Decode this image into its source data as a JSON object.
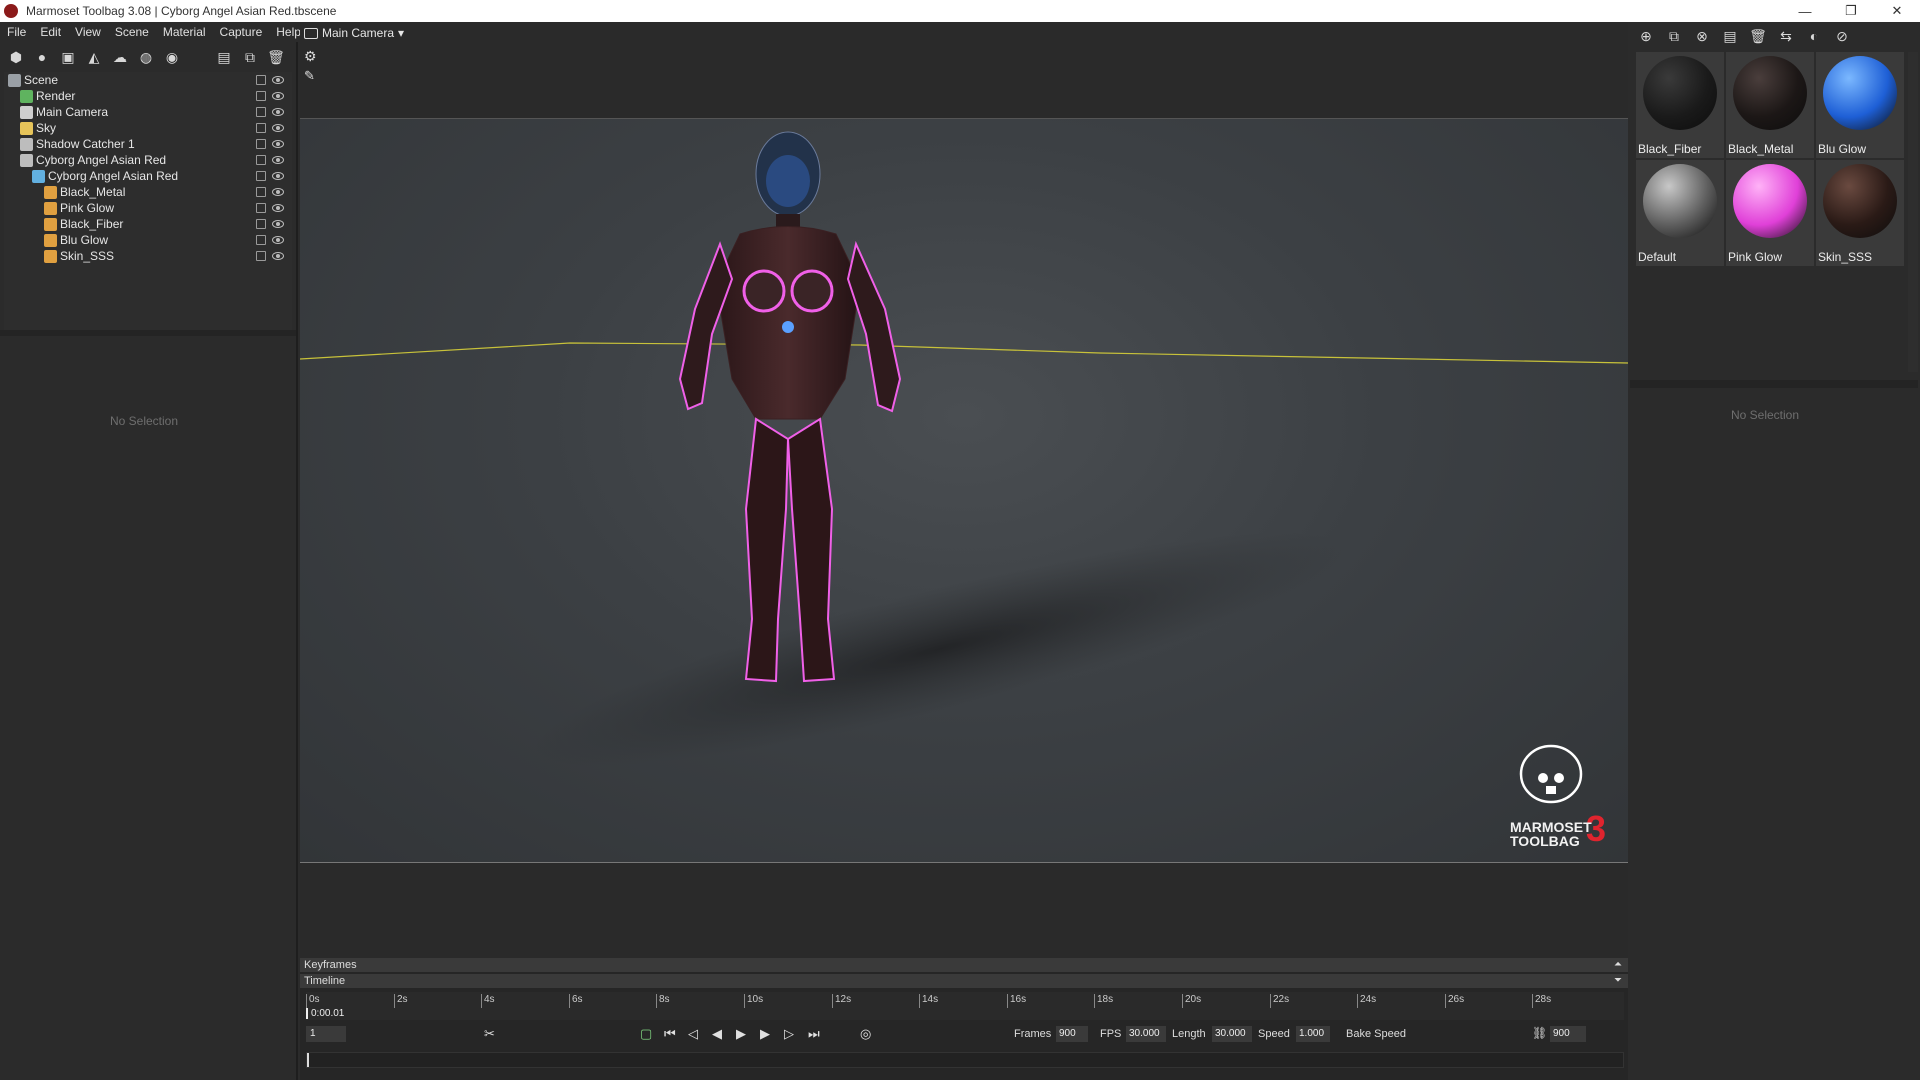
{
  "window": {
    "title": "Marmoset Toolbag 3.08  |  Cyborg Angel Asian Red.tbscene",
    "controls": {
      "minimize": "—",
      "restore": "❐",
      "close": "✕"
    }
  },
  "menu": [
    "File",
    "Edit",
    "View",
    "Scene",
    "Material",
    "Capture",
    "Help"
  ],
  "scene_tree": [
    {
      "label": "Scene",
      "indent": 0,
      "icon_color": "#9aa0a6"
    },
    {
      "label": "Render",
      "indent": 1,
      "icon_color": "#5fb35f"
    },
    {
      "label": "Main Camera",
      "indent": 1,
      "icon_color": "#cfcfcf"
    },
    {
      "label": "Sky",
      "indent": 1,
      "icon_color": "#e6c45a"
    },
    {
      "label": "Shadow Catcher 1",
      "indent": 1,
      "icon_color": "#bdbdbd"
    },
    {
      "label": "Cyborg Angel Asian Red",
      "indent": 1,
      "icon_color": "#bdbdbd"
    },
    {
      "label": "Cyborg Angel Asian Red",
      "indent": 2,
      "icon_color": "#62b0e0"
    },
    {
      "label": "Black_Metal",
      "indent": 3,
      "icon_color": "#e0a040"
    },
    {
      "label": "Pink Glow",
      "indent": 3,
      "icon_color": "#e0a040"
    },
    {
      "label": "Black_Fiber",
      "indent": 3,
      "icon_color": "#e0a040"
    },
    {
      "label": "Blu Glow",
      "indent": 3,
      "icon_color": "#e0a040"
    },
    {
      "label": "Skin_SSS",
      "indent": 3,
      "icon_color": "#e0a040"
    }
  ],
  "left_properties": {
    "empty_text": "No Selection"
  },
  "viewport": {
    "camera_label": "Main Camera"
  },
  "materials": [
    {
      "label": "Black_Fiber",
      "color": "#1a1a1a",
      "hl": "#3a3a3a"
    },
    {
      "label": "Black_Metal",
      "color": "#1c1716",
      "hl": "#4a3e3c"
    },
    {
      "label": "Blu Glow",
      "color": "#1e5fd6",
      "hl": "#7bb8ff"
    },
    {
      "label": "Default",
      "color": "#5e5e5e",
      "hl": "#c8c8c8"
    },
    {
      "label": "Pink Glow",
      "color": "#e040d8",
      "hl": "#ffb2f7"
    },
    {
      "label": "Skin_SSS",
      "color": "#2a1a16",
      "hl": "#6a4a40"
    }
  ],
  "right_properties": {
    "empty_text": "No Selection"
  },
  "timeline": {
    "keyframes_label": "Keyframes",
    "timeline_label": "Timeline",
    "ticks": [
      "0s",
      "2s",
      "4s",
      "6s",
      "8s",
      "10s",
      "12s",
      "14s",
      "16s",
      "18s",
      "20s",
      "22s",
      "24s",
      "26s",
      "28s"
    ],
    "current_time": "0:00.01",
    "current_frame": "1",
    "frames_label": "Frames",
    "frames": "900",
    "fps_label": "FPS",
    "fps": "30.000",
    "length_label": "Length",
    "length": "30.000",
    "speed_label": "Speed",
    "speed": "1.000",
    "bake_speed_label": "Bake Speed",
    "end_frame": "900"
  },
  "logo": {
    "line1": "MARMOSET",
    "line2": "TOOLBAG",
    "version": "3"
  }
}
